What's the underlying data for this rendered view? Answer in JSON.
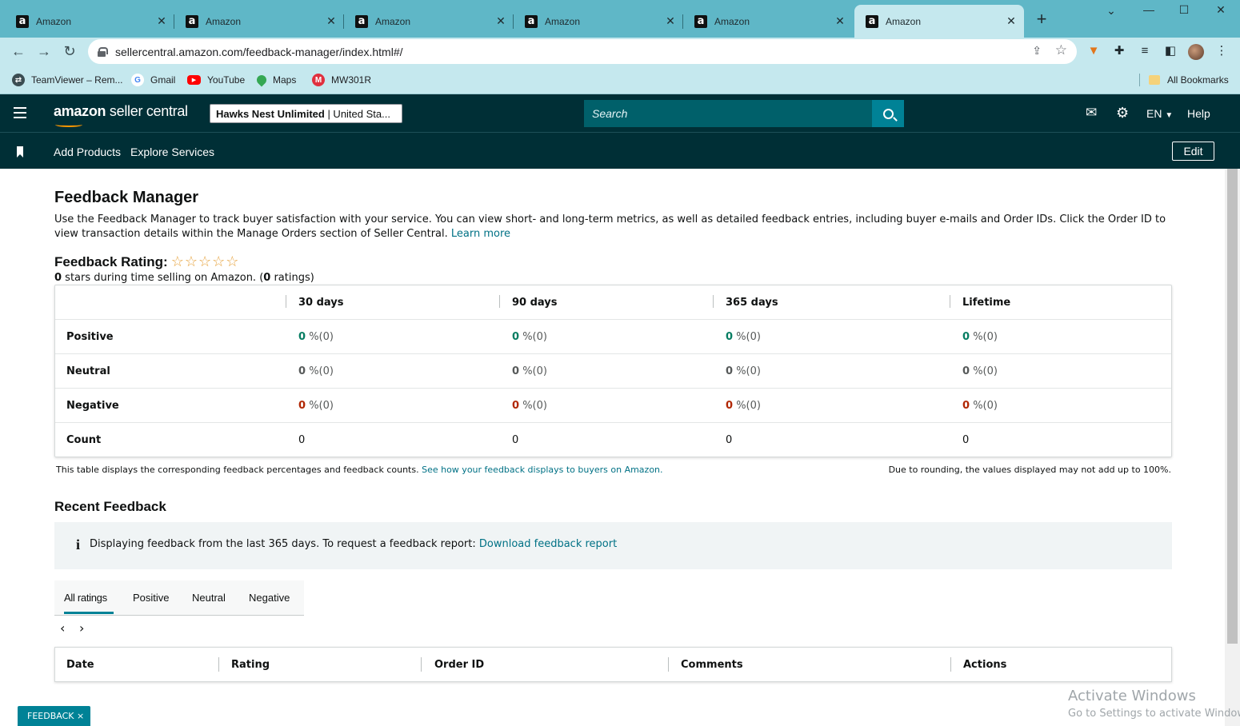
{
  "browser": {
    "tabs": [
      {
        "title": "Amazon",
        "favicon": "amazon-a"
      },
      {
        "title": "Amazon",
        "favicon": "amazon-a"
      },
      {
        "title": "Amazon",
        "favicon": "amazon-a"
      },
      {
        "title": "Amazon",
        "favicon": "amazon-a"
      },
      {
        "title": "Amazon",
        "favicon": "amazon-a"
      },
      {
        "title": "Amazon",
        "favicon": "amazon-a",
        "active": true
      }
    ],
    "url": "sellercentral.amazon.com/feedback-manager/index.html#/",
    "bookmarks": [
      {
        "label": "TeamViewer – Rem...",
        "icon": "teamviewer-icon"
      },
      {
        "label": "Gmail",
        "icon": "google-icon"
      },
      {
        "label": "YouTube",
        "icon": "youtube-icon"
      },
      {
        "label": "Maps",
        "icon": "maps-icon"
      },
      {
        "label": "MW301R",
        "icon": "mercusys-icon"
      }
    ],
    "all_bookmarks": "All Bookmarks"
  },
  "header": {
    "logo_text_bold": "amazon",
    "logo_text": " seller central",
    "store_name": "Hawks Nest Unlimited",
    "store_region": " | United Sta...",
    "search_placeholder": "Search",
    "language": "EN",
    "help": "Help"
  },
  "nav": {
    "items": [
      "Add Products",
      "Explore Services"
    ],
    "edit": "Edit"
  },
  "page": {
    "title": "Feedback Manager",
    "intro": "Use the Feedback Manager to track buyer satisfaction with your service. You can view short- and long-term metrics, as well as detailed feedback entries, including buyer e-mails and Order IDs. Click the Order ID to view transaction details within the Manage Orders section of Seller Central.",
    "learn_more": "Learn more",
    "rating_label": "Feedback Rating:",
    "stars": "☆☆☆☆☆",
    "rating_stars_value": "0",
    "rating_mid": " stars during time selling on Amazon. (",
    "rating_count": "0",
    "rating_end": " ratings)"
  },
  "feedback_table": {
    "columns": [
      "30 days",
      "90 days",
      "365 days",
      "Lifetime"
    ],
    "rows": [
      {
        "label": "Positive",
        "values": [
          "0",
          "0",
          "0",
          "0"
        ],
        "suffix": "%(0)"
      },
      {
        "label": "Neutral",
        "values": [
          "0",
          "0",
          "0",
          "0"
        ],
        "suffix": "%(0)"
      },
      {
        "label": "Negative",
        "values": [
          "0",
          "0",
          "0",
          "0"
        ],
        "suffix": "%(0)"
      },
      {
        "label": "Count",
        "values": [
          "0",
          "0",
          "0",
          "0"
        ]
      }
    ],
    "note": "This table displays the corresponding feedback percentages and feedback counts.",
    "note_link": "See how your feedback displays to buyers on Amazon.",
    "rounding_note": "Due to rounding, the values displayed may not add up to 100%."
  },
  "recent": {
    "title": "Recent Feedback",
    "info": "Displaying feedback from the last 365 days. To request a feedback report:",
    "info_link": "Download feedback report",
    "tabs": [
      "All ratings",
      "Positive",
      "Neutral",
      "Negative"
    ],
    "columns": [
      "Date",
      "Rating",
      "Order ID",
      "Comments",
      "Actions"
    ]
  },
  "footer": {
    "feedback_tab": "FEEDBACK ×",
    "activate_title": "Activate Windows",
    "activate_sub": "Go to Settings to activate Windows."
  },
  "colors": {
    "header_bg": "#002f36",
    "tabstrip_bg": "#5fb7c7",
    "accent_teal": "#008296",
    "link": "#007185",
    "positive": "#067d62",
    "negative": "#b12704",
    "star": "#e6a23c"
  }
}
